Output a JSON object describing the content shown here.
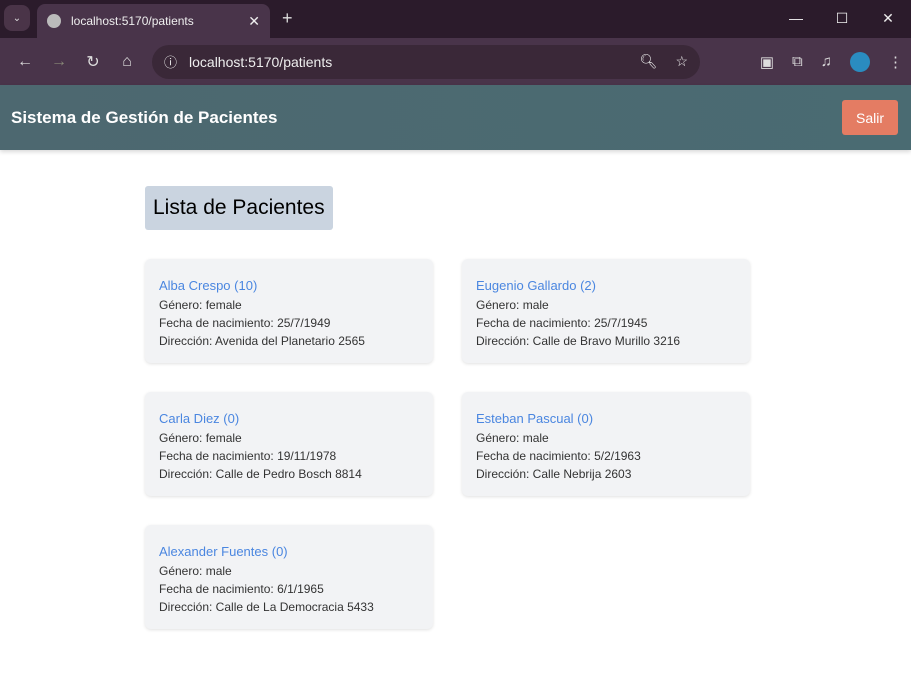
{
  "browser": {
    "tab_title": "localhost:5170/patients",
    "url": "localhost:5170/patients"
  },
  "app": {
    "title": "Sistema de Gestión de Pacientes",
    "logout_label": "Salir"
  },
  "page": {
    "heading": "Lista de Pacientes",
    "patients": [
      {
        "name": "Alba Crespo (10)",
        "gender": "Género: female",
        "birth": "Fecha de nacimiento: 25/7/1949",
        "address": "Dirección: Avenida del Planetario 2565"
      },
      {
        "name": "Eugenio Gallardo (2)",
        "gender": "Género: male",
        "birth": "Fecha de nacimiento: 25/7/1945",
        "address": "Dirección: Calle de Bravo Murillo 3216"
      },
      {
        "name": "Carla Diez (0)",
        "gender": "Género: female",
        "birth": "Fecha de nacimiento: 19/11/1978",
        "address": "Dirección: Calle de Pedro Bosch 8814"
      },
      {
        "name": "Esteban Pascual (0)",
        "gender": "Género: male",
        "birth": "Fecha de nacimiento: 5/2/1963",
        "address": "Dirección: Calle Nebrija 2603"
      },
      {
        "name": "Alexander Fuentes (0)",
        "gender": "Género: male",
        "birth": "Fecha de nacimiento: 6/1/1965",
        "address": "Dirección: Calle de La Democracia 5433"
      }
    ]
  }
}
